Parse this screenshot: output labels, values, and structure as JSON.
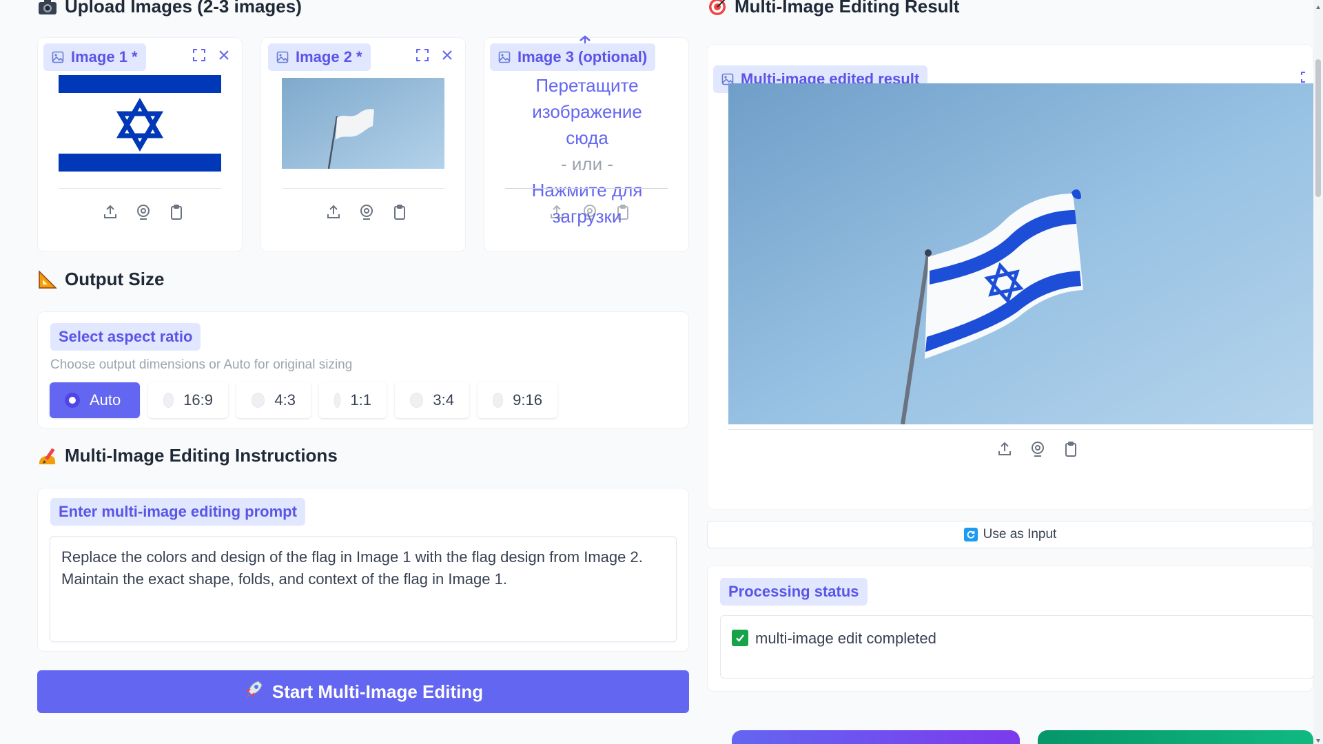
{
  "upload": {
    "title": "Upload Images (2-3 images)",
    "image1_label": "Image 1 *",
    "image2_label": "Image 2 *",
    "image3_label": "Image 3 (optional)",
    "drop_text_1": "Перетащите",
    "drop_text_2": "изображение",
    "drop_text_3": "сюда",
    "drop_or": "- или -",
    "drop_click_1": "Нажмите для",
    "drop_click_2": "загрузки"
  },
  "output_size": {
    "title": "Output Size",
    "label": "Select aspect ratio",
    "info": "Choose output dimensions or Auto for original sizing",
    "options": [
      "Auto",
      "16:9",
      "4:3",
      "1:1",
      "3:4",
      "9:16"
    ],
    "selected": "Auto"
  },
  "instructions": {
    "title": "Multi-Image Editing Instructions",
    "label": "Enter multi-image editing prompt",
    "prompt": "Replace the colors and design of the flag in Image 1 with the flag design from Image 2. Maintain the exact shape, folds, and context of the flag in Image 1."
  },
  "start_button": "Start Multi-Image Editing",
  "result": {
    "title": "Multi-Image Editing Result",
    "image_label": "Multi-image edited result",
    "use_as_input": "Use as Input",
    "status_label": "Processing status",
    "status_text": "multi-image edit completed"
  },
  "colors": {
    "accent": "#6366f1",
    "chip_bg": "#e0e7ff",
    "chip_text": "#5b54e6",
    "flag_blue": "#0038b8",
    "sky": "#9cc3e0"
  }
}
